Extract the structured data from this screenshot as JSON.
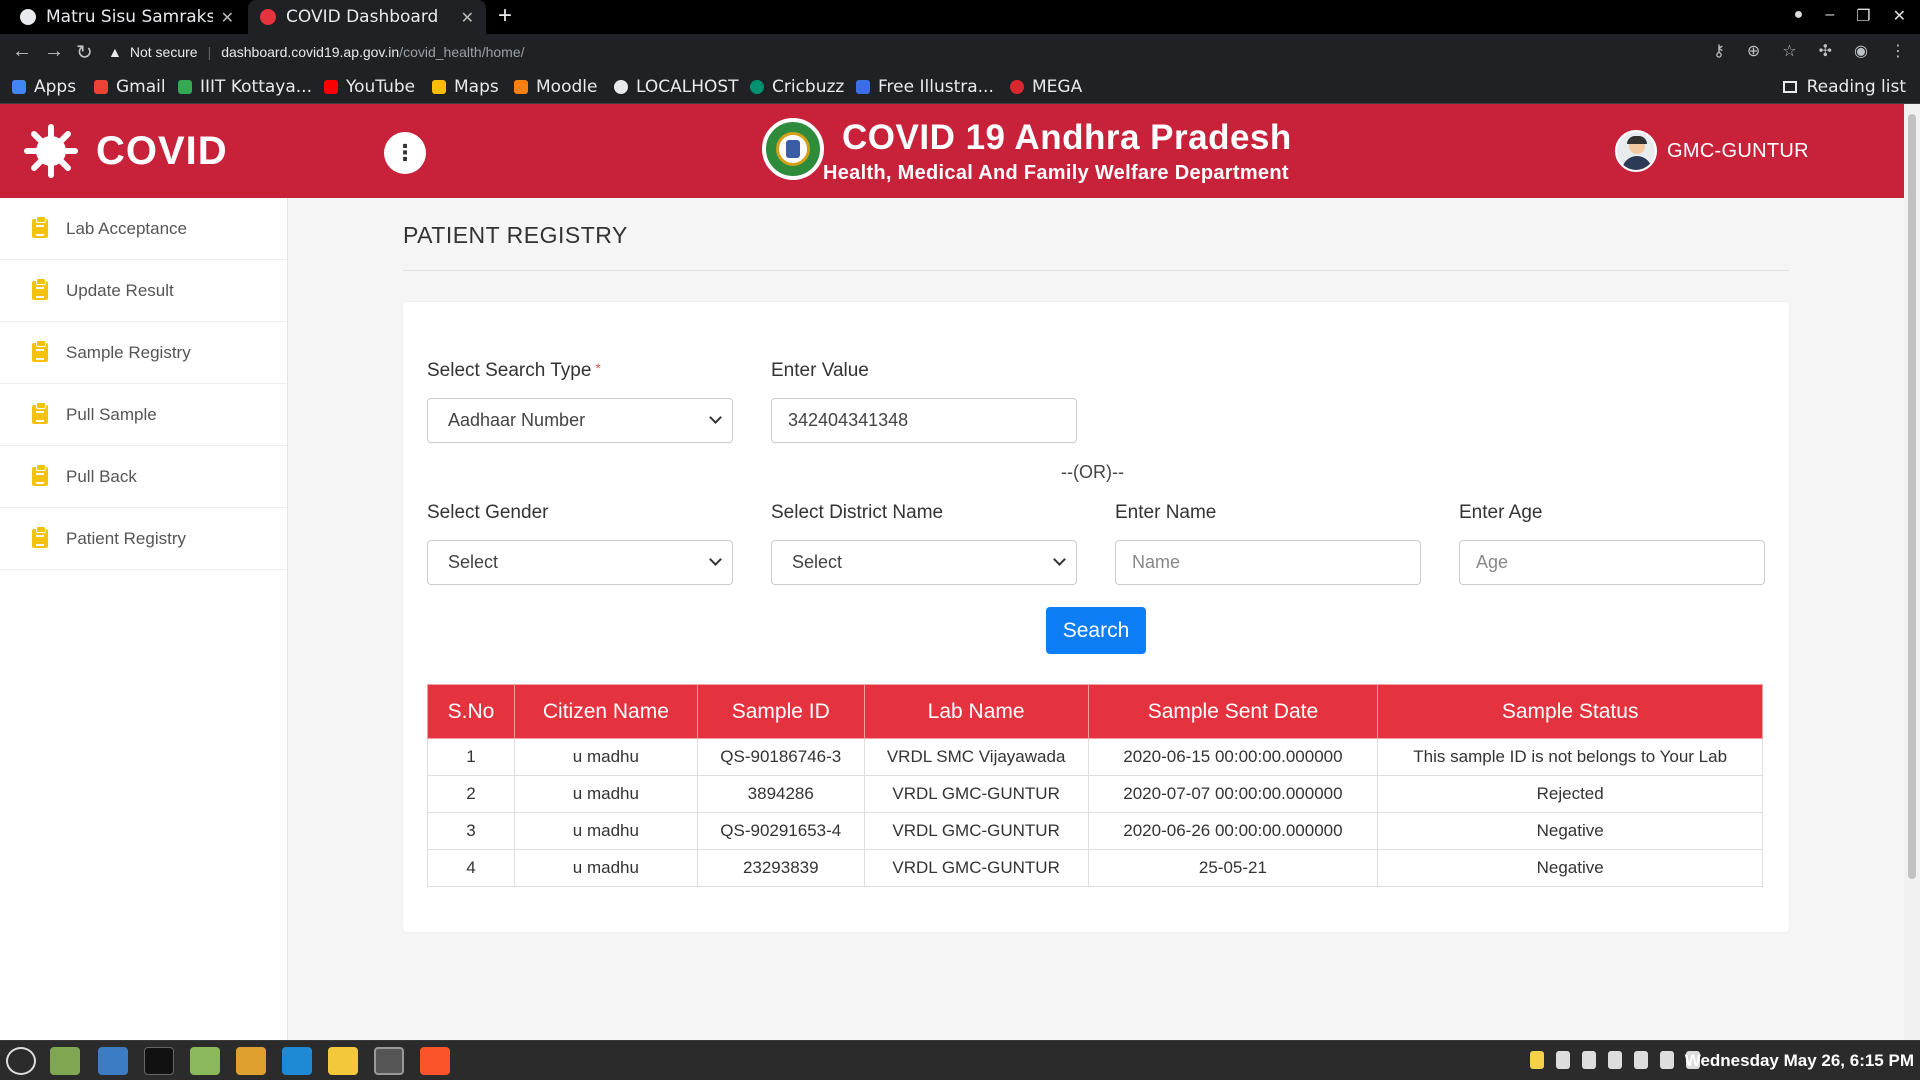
{
  "browser": {
    "tabs": [
      {
        "title": "Matru Sisu Samraksha",
        "active": false
      },
      {
        "title": "COVID Dashboard",
        "active": true
      }
    ],
    "security_label": "Not secure",
    "url_host": "dashboard.covid19.ap.gov.in",
    "url_path": "/covid_health/home/",
    "bookmarks": [
      "Apps",
      "Gmail",
      "IIIT Kottaya...",
      "YouTube",
      "Maps",
      "Moodle",
      "LOCALHOST",
      "Cricbuzz",
      "Free Illustra...",
      "MEGA"
    ],
    "reading_list": "Reading list"
  },
  "header": {
    "brand": "COVID",
    "title": "COVID 19 Andhra Pradesh",
    "subtitle": "Health, Medical And Family Welfare Department",
    "user": "GMC-GUNTUR",
    "accent_color": "#c8213a"
  },
  "sidebar": {
    "items": [
      {
        "label": "Lab Acceptance",
        "icon": "clipboard-icon"
      },
      {
        "label": "Update Result",
        "icon": "clipboard-icon"
      },
      {
        "label": "Sample Registry",
        "icon": "clipboard-icon"
      },
      {
        "label": "Pull Sample",
        "icon": "clipboard-icon"
      },
      {
        "label": "Pull Back",
        "icon": "clipboard-icon"
      },
      {
        "label": "Patient Registry",
        "icon": "clipboard-icon"
      }
    ]
  },
  "main": {
    "page_title": "PATIENT REGISTRY",
    "form": {
      "search_type_label": "Select Search Type",
      "required_mark": "*",
      "search_type_value": "Aadhaar Number",
      "value_label": "Enter Value",
      "value": "342404341348",
      "or_text": "--(OR)--",
      "gender_label": "Select Gender",
      "gender_value": "Select",
      "district_label": "Select District Name",
      "district_value": "Select",
      "name_label": "Enter Name",
      "name_placeholder": "Name",
      "age_label": "Enter Age",
      "age_placeholder": "Age",
      "search_button": "Search"
    },
    "table": {
      "headers": [
        "S.No",
        "Citizen Name",
        "Sample ID",
        "Lab Name",
        "Sample Sent Date",
        "Sample Status"
      ],
      "rows": [
        [
          "1",
          "u madhu",
          "QS-90186746-3",
          "VRDL SMC Vijayawada",
          "2020-06-15 00:00:00.000000",
          "This sample ID is not belongs to Your Lab"
        ],
        [
          "2",
          "u madhu",
          "3894286",
          "VRDL GMC-GUNTUR",
          "2020-07-07 00:00:00.000000",
          "Rejected"
        ],
        [
          "3",
          "u madhu",
          "QS-90291653-4",
          "VRDL GMC-GUNTUR",
          "2020-06-26 00:00:00.000000",
          "Negative"
        ],
        [
          "4",
          "u madhu",
          "23293839",
          "VRDL GMC-GUNTUR",
          "25-05-21",
          "Negative"
        ]
      ],
      "header_color": "#e5323f"
    }
  },
  "taskbar": {
    "clock": "Wednesday May 26,  6:15 PM"
  }
}
